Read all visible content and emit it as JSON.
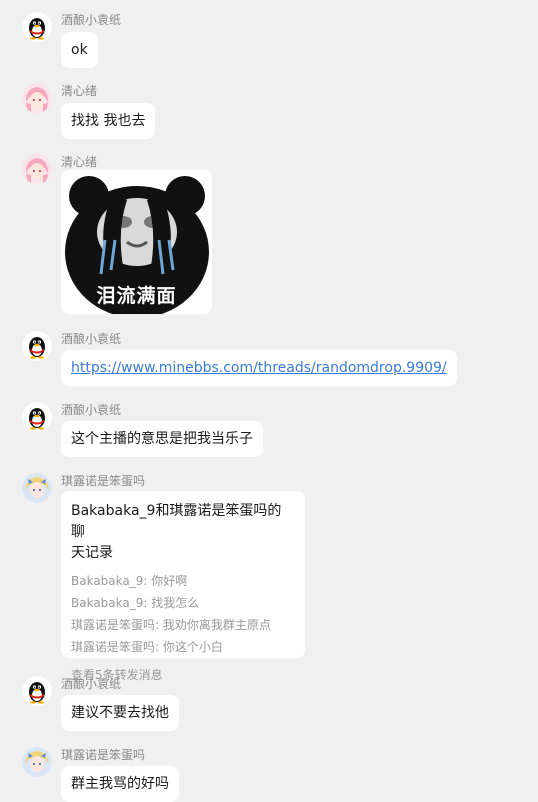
{
  "messages": [
    {
      "sender": "酒酿小袁纸",
      "text": "ok"
    },
    {
      "sender": "清心绪",
      "text": "找找 我也去"
    },
    {
      "sender": "清心绪",
      "sticker_caption": "泪流满面"
    },
    {
      "sender": "酒酿小袁纸",
      "link": "https://www.minebbs.com/threads/randomdrop.9909/"
    },
    {
      "sender": "酒酿小袁纸",
      "text": "这个主播的意思是把我当乐子"
    },
    {
      "sender": "琪露诺是笨蛋吗"
    },
    {
      "sender": "酒酿小袁纸",
      "text": "建议不要去找他"
    },
    {
      "sender": "琪露诺是笨蛋吗",
      "text": "群主我骂的好吗"
    }
  ],
  "forward": {
    "title_line1": "Bakabaka_9和琪露诺是笨蛋吗的聊",
    "title_line2": "天记录",
    "lines": [
      "Bakabaka_9: 你好啊",
      "Bakabaka_9: 找我怎么",
      "琪露诺是笨蛋吗: 我劝你离我群主原点",
      "琪露诺是笨蛋吗: 你这个小白"
    ],
    "footer": "查看5条转发消息"
  },
  "colors": {
    "background": "#f0f0f0",
    "bubble": "#ffffff",
    "link": "#3a7bd5",
    "sender": "#8a8a8a"
  },
  "icons": {
    "qq_penguin": "penguin-avatar-icon",
    "anime_pink": "anime-avatar-icon",
    "anime_blue": "anime-avatar-icon"
  }
}
